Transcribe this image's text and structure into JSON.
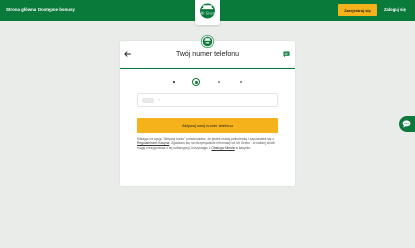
{
  "header": {
    "nav": [
      {
        "label": "Strona główna"
      },
      {
        "label": "Dostępne bonusy"
      }
    ],
    "logo_text": "Mr Green",
    "register_label": "Zarejestruj się",
    "login_label": "Zaloguj się",
    "brand_color": "#0a7a3b",
    "accent_color": "#f6b21b"
  },
  "card": {
    "title": "Twój numer telefonu",
    "back_icon": "arrow-left-icon",
    "chat_icon": "chat-bubble-icon",
    "steps": {
      "total": 4,
      "current": 2
    },
    "phone": {
      "prefix": "+",
      "value": ""
    },
    "activate_label": "Aktywuj swój numer telefonu",
    "legal": {
      "part1": "Klikając na opcję \"Aktywuj konto\" potwierdzasz, że jesteś osobą pełnoletnią i zapoznałeś się z ",
      "link1": "Regulaminem Kasyna",
      "part2": ". Zgadzam się na otrzymywanie informacji od Mr Green - w każdej chwili mogę zrezygnować z tej subskrypcji, korzystając z ",
      "link2": "Obsługa Klienta",
      "part3": " w kasynie."
    }
  }
}
